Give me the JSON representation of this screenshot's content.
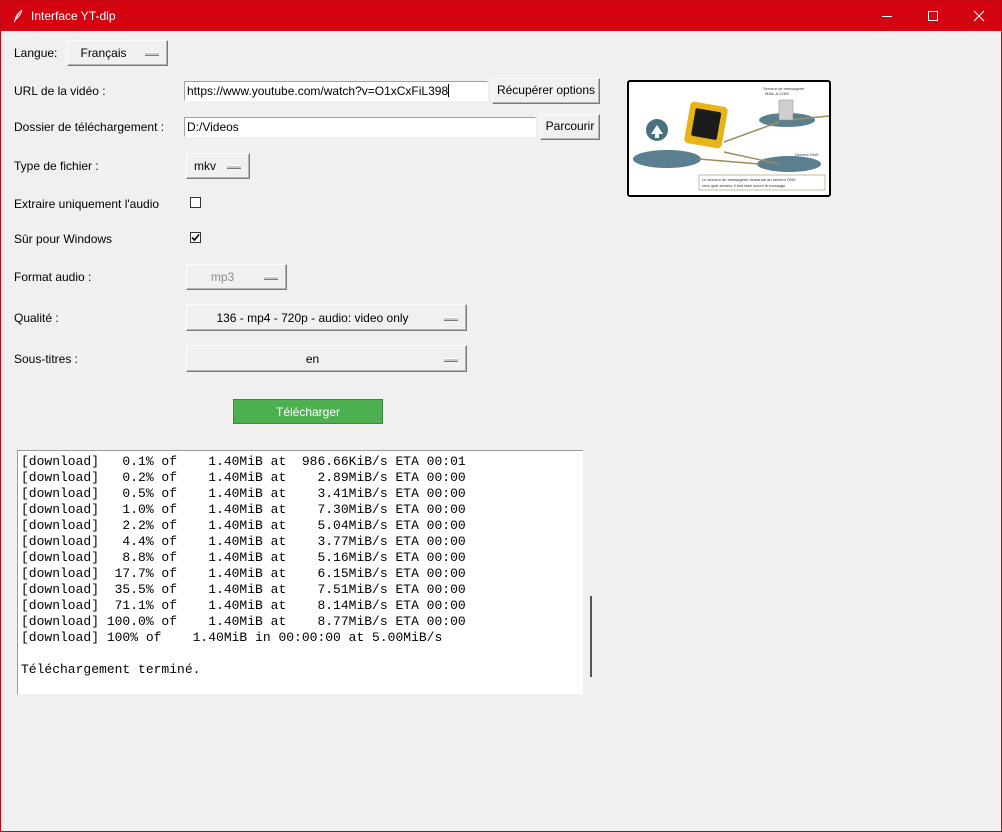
{
  "window": {
    "title": "Interface YT-dlp",
    "accent": "#d40511"
  },
  "form": {
    "language_label": "Langue:",
    "language_value": "Français",
    "url_label": "URL de la vidéo :",
    "url_value": "https://www.youtube.com/watch?v=O1xCxFiL398",
    "fetch_button": "Récupérer options",
    "folder_label": "Dossier de téléchargement :",
    "folder_value": "D:/Videos",
    "browse_button": "Parcourir",
    "filetype_label": "Type de fichier :",
    "filetype_value": "mkv",
    "audio_only_label": "Extraire uniquement l'audio",
    "audio_only_checked": false,
    "windows_safe_label": "Sûr pour Windows",
    "windows_safe_checked": true,
    "audio_format_label": "Format audio :",
    "audio_format_value": "mp3",
    "quality_label": "Qualité :",
    "quality_value": "136 - mp4 - 720p - audio: video only",
    "subtitles_label": "Sous-titres :",
    "subtitles_value": "en",
    "download_button": "Télécharger",
    "download_color": "#4caf50"
  },
  "thumbnail": {
    "label_top": "Serveur de messagerie",
    "label_top2": "MAIL.A.COM",
    "label_right": "Serveur DNS",
    "caption_line1": "Le serveur de messagerie demande au serveur DNS",
    "caption_line2": "vers quel serveur il doit faire suivre le message"
  },
  "log": {
    "lines": [
      "[download]   0.1% of    1.40MiB at  986.66KiB/s ETA 00:01",
      "[download]   0.2% of    1.40MiB at    2.89MiB/s ETA 00:00",
      "[download]   0.5% of    1.40MiB at    3.41MiB/s ETA 00:00",
      "[download]   1.0% of    1.40MiB at    7.30MiB/s ETA 00:00",
      "[download]   2.2% of    1.40MiB at    5.04MiB/s ETA 00:00",
      "[download]   4.4% of    1.40MiB at    3.77MiB/s ETA 00:00",
      "[download]   8.8% of    1.40MiB at    5.16MiB/s ETA 00:00",
      "[download]  17.7% of    1.40MiB at    6.15MiB/s ETA 00:00",
      "[download]  35.5% of    1.40MiB at    7.51MiB/s ETA 00:00",
      "[download]  71.1% of    1.40MiB at    8.14MiB/s ETA 00:00",
      "[download] 100.0% of    1.40MiB at    8.77MiB/s ETA 00:00",
      "[download] 100% of    1.40MiB in 00:00:00 at 5.00MiB/s",
      "",
      "Téléchargement terminé."
    ]
  }
}
